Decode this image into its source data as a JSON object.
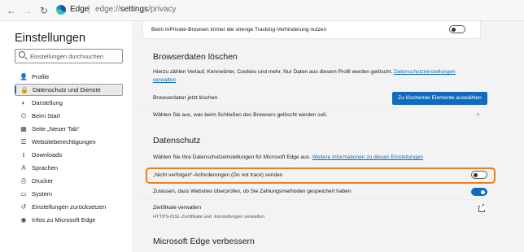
{
  "browser": {
    "app_name": "Edge",
    "separator": "|",
    "url_prefix": "edge://",
    "url_bold": "settings",
    "url_suffix": "/privacy"
  },
  "sidebar": {
    "title": "Einstellungen",
    "search_placeholder": "Einstellungen durchsuchen",
    "items": [
      {
        "label": "Profile",
        "icon": "profile-icon",
        "glyph": "👤"
      },
      {
        "label": "Datenschutz und Dienste",
        "icon": "lock-icon",
        "glyph": "🔒",
        "active": true
      },
      {
        "label": "Darstellung",
        "icon": "appearance-icon",
        "glyph": "◐"
      },
      {
        "label": "Beim Start",
        "icon": "power-icon",
        "glyph": "⏻"
      },
      {
        "label": "Seite „Neuer Tab“",
        "icon": "new-tab-icon",
        "glyph": "▦"
      },
      {
        "label": "Websiteberechtigungen",
        "icon": "permissions-icon",
        "glyph": "☰"
      },
      {
        "label": "Downloads",
        "icon": "download-icon",
        "glyph": "⭳"
      },
      {
        "label": "Sprachen",
        "icon": "language-icon",
        "glyph": "A"
      },
      {
        "label": "Drucker",
        "icon": "printer-icon",
        "glyph": "⎙"
      },
      {
        "label": "System",
        "icon": "system-icon",
        "glyph": "▭"
      },
      {
        "label": "Einstellungen zurücksetzen",
        "icon": "reset-icon",
        "glyph": "↺"
      },
      {
        "label": "Infos zu Microsoft Edge",
        "icon": "edge-icon",
        "glyph": "◉"
      }
    ]
  },
  "main": {
    "inprivate_label": "Beim InPrivate-Browsen immer die strenge Tracking-Verhinderung nutzen",
    "inprivate_on": false,
    "browserdaten": {
      "heading": "Browserdaten löschen",
      "desc": "Hierzu zählen Verlauf, Kennwörter, Cookies und mehr. Nur Daten aus diesem Profil werden gelöscht.",
      "desc_link_1": "Datenschutzeinstellungen",
      "desc_link_2": "verwalten",
      "row_label": "Browserdaten jetzt löschen",
      "button_label": "Zu löschende Elemente auswählen",
      "close_label": "Wählen Sie aus, was beim Schließen des Browsers gelöscht werden soll."
    },
    "datenschutz": {
      "heading": "Datenschutz",
      "desc": "Wählen Sie Ihre Datenschutzeinstellungen für Microsoft Edge aus.",
      "desc_link": "Weitere Informationen zu diesen Einstellungen",
      "dnt_label": "„Nicht verfolgen“-Anforderungen (Do not track) senden",
      "dnt_on": false,
      "payment_label": "Zulassen, dass Websites überprüfen, ob Sie Zahlungsmethoden gespeichert haben",
      "payment_on": true,
      "cert_label": "Zertifikate verwalten",
      "cert_sub": "HTTPS-/SSL-Zertifikate und -Einstellungen verwalten"
    },
    "improve_heading": "Microsoft Edge verbessern"
  },
  "colors": {
    "accent": "#0f6cbd",
    "highlight": "#ee7f1e"
  }
}
